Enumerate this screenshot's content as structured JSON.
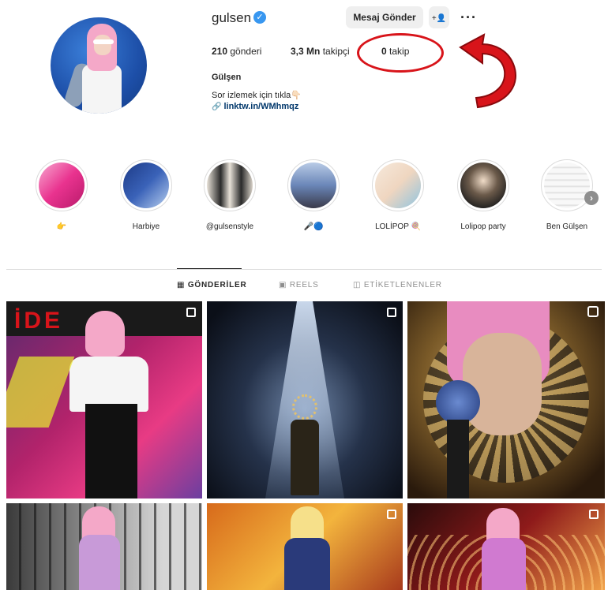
{
  "profile": {
    "username": "gulsen",
    "full_name": "Gülşen",
    "bio": "Sor izlemek için tıkla👇🏻",
    "link": "linktw.in/WMhmqz",
    "verified_symbol": "✓"
  },
  "actions": {
    "message_label": "Mesaj Gönder",
    "add_user_symbol": "+👤",
    "more_symbol": "···"
  },
  "stats": {
    "posts": "210",
    "posts_label": "gönderi",
    "followers": "3,3 Mn",
    "followers_label": "takipçi",
    "following": "0",
    "following_label": "takip"
  },
  "highlights": [
    {
      "label": "👉",
      "color": "#e9338f"
    },
    {
      "label": "Harbiye",
      "color": "#3a62b8"
    },
    {
      "label": "@gulsenstyle",
      "color": "#d8d2c8"
    },
    {
      "label": "🎤🔵",
      "color": "#6a86b8"
    },
    {
      "label": "LOLİPOP 🍭",
      "color": "#efd6c0"
    },
    {
      "label": "Lolipop party",
      "color": "#1d1d1d"
    },
    {
      "label": "Ben Gülşen",
      "color": "#f1f1f1"
    }
  ],
  "highlights_next_symbol": "›",
  "tabs": [
    {
      "label": "▦ GÖNDERİLER",
      "active": true
    },
    {
      "label": "▣ REELS",
      "active": false
    },
    {
      "label": "◫ ETİKETLENENLER",
      "active": false
    }
  ],
  "annotation": {
    "highlight_color": "#d8141a"
  },
  "posts_grid": {
    "top_left_sign_text": "İDE"
  }
}
